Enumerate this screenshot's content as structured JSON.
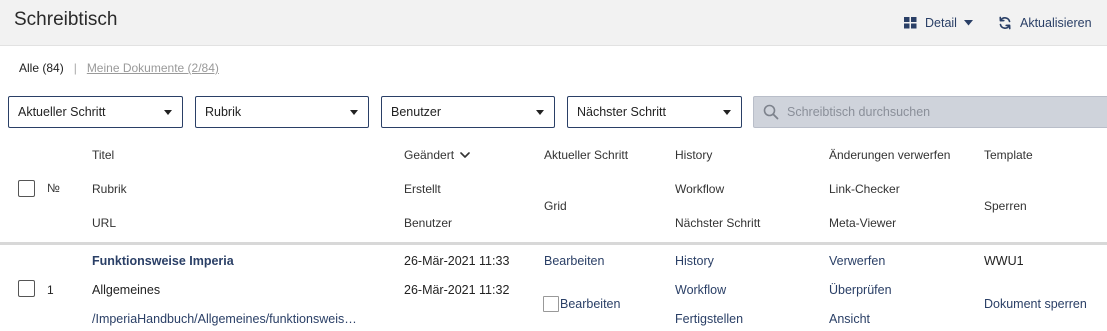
{
  "header": {
    "title": "Schreibtisch",
    "detail_label": "Detail",
    "refresh_label": "Aktualisieren"
  },
  "tabs": {
    "all": "Alle (84)",
    "separator": "|",
    "mine": "Meine Dokumente (2/84)"
  },
  "filters": {
    "current_step": "Aktueller Schritt",
    "category": "Rubrik",
    "user": "Benutzer",
    "next_step": "Nächster Schritt",
    "search_placeholder": "Schreibtisch durchsuchen"
  },
  "columns": {
    "number": "№",
    "title": "Titel",
    "category": "Rubrik",
    "url": "URL",
    "changed": "Geändert",
    "created": "Erstellt",
    "user": "Benutzer",
    "current_step": "Aktueller Schritt",
    "grid": "Grid",
    "history": "History",
    "workflow": "Workflow",
    "next_step": "Nächster Schritt",
    "discard_changes": "Änderungen verwerfen",
    "link_checker": "Link-Checker",
    "meta_viewer": "Meta-Viewer",
    "template": "Template",
    "lock": "Sperren"
  },
  "rows": [
    {
      "number": "1",
      "title": "Funktionsweise Imperia",
      "category": "Allgemeines",
      "url": "/ImperiaHandbuch/Allgemeines/funktionsweis…",
      "changed": "26-Mär-2021 11:33",
      "created": "26-Mär-2021 11:32",
      "edit_current": "Bearbeiten",
      "edit_grid": "Bearbeiten",
      "history": "History",
      "workflow": "Workflow",
      "finish": "Fertigstellen",
      "discard": "Verwerfen",
      "check": "Überprüfen",
      "view": "Ansicht",
      "template": "WWU1",
      "lock_document": "Dokument sperren"
    }
  ],
  "colors": {
    "accent": "#2a3f66",
    "header_bg": "#f2f2f2",
    "search_bg": "#cfd3db"
  },
  "icons": {
    "detail": "grid-icon",
    "detail_caret": "caret-down-icon",
    "refresh": "refresh-icon",
    "search": "search-icon",
    "sort": "chevron-down-icon"
  }
}
